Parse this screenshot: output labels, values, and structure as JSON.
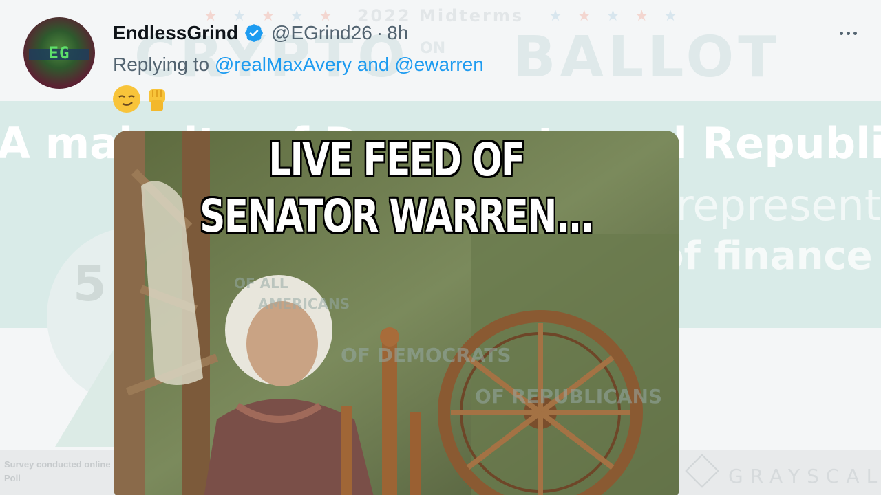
{
  "background": {
    "kicker": "2022 Midterms",
    "title_left": "CRYPTO",
    "title_on": "ON",
    "title_right": "BALLOT",
    "line1": "A majority of Democrats and Republicans",
    "line2": "believe crypto represents",
    "line3": "the future of finance",
    "overlay_lines": [
      "OF ALL",
      "AMERICANS",
      "OF DEMOCRATS",
      "OF REPUBLICANS"
    ],
    "stat": "5",
    "survey": "Survey conducted online by The Harris Poll",
    "brand": "GRAYSCALE"
  },
  "tweet": {
    "display_name": "EndlessGrind",
    "handle": "@EGrind26",
    "separator": "·",
    "time": "8h",
    "avatar_text": "EG",
    "replying_prefix": "Replying to",
    "mention1": "@realMaxAvery",
    "and_text": "and",
    "mention2": "@ewarren",
    "emojis": [
      "smirking-face",
      "raised-fist"
    ],
    "media": {
      "caption_line1": "LIVE FEED OF",
      "caption_line2": "SENATOR WARREN..."
    }
  },
  "colors": {
    "accent": "#1d9bf0",
    "text_primary": "#0f1419",
    "text_secondary": "#536471"
  }
}
